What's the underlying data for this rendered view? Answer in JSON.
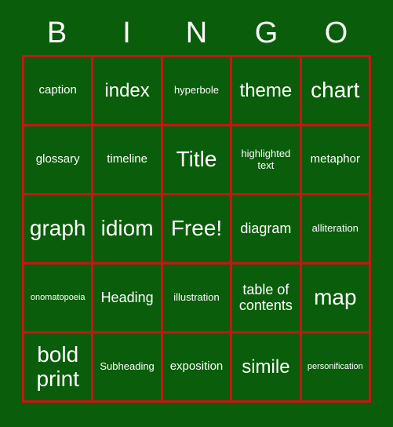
{
  "card": {
    "title_letters": [
      "B",
      "I",
      "N",
      "G",
      "O"
    ],
    "background_color": "#0a5d0a",
    "border_color": "#c81414",
    "text_color": "#ffffff",
    "rows": 5,
    "columns": 5,
    "cells": [
      [
        {
          "label": "caption",
          "size": "m"
        },
        {
          "label": "index",
          "size": "xl"
        },
        {
          "label": "hyperbole",
          "size": "s"
        },
        {
          "label": "theme",
          "size": "xl"
        },
        {
          "label": "chart",
          "size": "xxl"
        }
      ],
      [
        {
          "label": "glossary",
          "size": "m"
        },
        {
          "label": "timeline",
          "size": "m"
        },
        {
          "label": "Title",
          "size": "xxl"
        },
        {
          "label": "highlighted text",
          "size": "s"
        },
        {
          "label": "metaphor",
          "size": "m"
        }
      ],
      [
        {
          "label": "graph",
          "size": "xxl"
        },
        {
          "label": "idiom",
          "size": "xxl"
        },
        {
          "label": "Free!",
          "size": "xxl"
        },
        {
          "label": "diagram",
          "size": "l"
        },
        {
          "label": "alliteration",
          "size": "s"
        }
      ],
      [
        {
          "label": "onomatopoeia",
          "size": "xs"
        },
        {
          "label": "Heading",
          "size": "l"
        },
        {
          "label": "illustration",
          "size": "s"
        },
        {
          "label": "table of contents",
          "size": "l"
        },
        {
          "label": "map",
          "size": "xxl"
        }
      ],
      [
        {
          "label": "bold print",
          "size": "xxl"
        },
        {
          "label": "Subheading",
          "size": "s"
        },
        {
          "label": "exposition",
          "size": "m"
        },
        {
          "label": "simile",
          "size": "xl"
        },
        {
          "label": "personification",
          "size": "xs"
        }
      ]
    ]
  }
}
